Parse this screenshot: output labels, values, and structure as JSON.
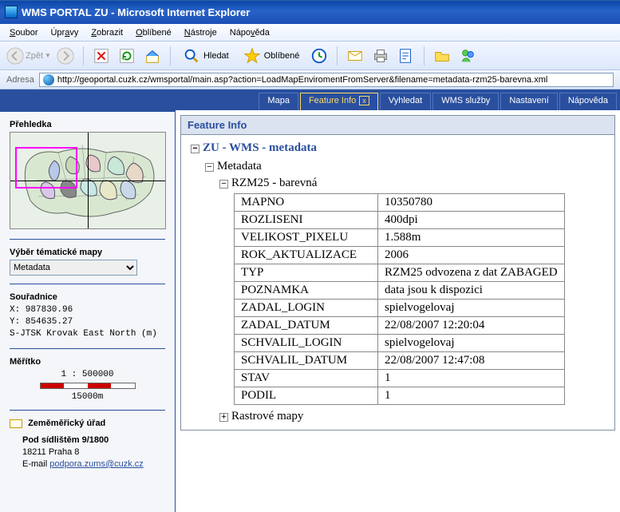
{
  "window": {
    "title": "WMS PORTAL ZU - Microsoft Internet Explorer"
  },
  "menu": {
    "file": "Soubor",
    "edit": "Úpravy",
    "view": "Zobrazit",
    "favorites": "Oblíbené",
    "tools": "Nástroje",
    "help": "Nápověda"
  },
  "toolbar": {
    "back": "Zpět",
    "search": "Hledat",
    "favorites": "Oblíbené"
  },
  "address": {
    "label": "Adresa",
    "url": "http://geoportal.cuzk.cz/wmsportal/main.asp?action=LoadMapEnviromentFromServer&filename=metadata-rzm25-barevna.xml"
  },
  "tabs": {
    "map": "Mapa",
    "feature": "Feature Info",
    "search": "Vyhledat",
    "wms": "WMS služby",
    "settings": "Nastavení",
    "help": "Nápověda"
  },
  "sidebar": {
    "overview_title": "Přehledka",
    "themap_label": "Výběr tématické mapy",
    "themap_value": "Metadata",
    "coords_title": "Souřadnice",
    "x": "X: 987830.96",
    "y": "Y: 854635.27",
    "sys": "S-JTSK Krovak East North (m)",
    "scale_title": "Měřítko",
    "scale_ratio": "1 : 500000",
    "scale_dist": "15000m",
    "office": "Zeměměřický úřad",
    "addr1": "Pod sídlištěm 9/1800",
    "addr2": "18211 Praha 8",
    "email_label": "E-mail ",
    "email": "podpora.zums@cuzk.cz"
  },
  "feature": {
    "title": "Feature Info",
    "group": "ZU - WMS - metadata",
    "sec1": "Metadata",
    "sec2": "RZM25 - barevná",
    "sec3": "Rastrové mapy",
    "table": [
      [
        "MAPNO",
        "10350780"
      ],
      [
        "ROZLISENI",
        "400dpi"
      ],
      [
        "VELIKOST_PIXELU",
        "1.588m"
      ],
      [
        "ROK_AKTUALIZACE",
        "2006"
      ],
      [
        "TYP",
        "RZM25 odvozena z dat ZABAGED"
      ],
      [
        "POZNAMKA",
        "data jsou k dispozici"
      ],
      [
        "ZADAL_LOGIN",
        "spielvogelovaj"
      ],
      [
        "ZADAL_DATUM",
        "22/08/2007 12:20:04"
      ],
      [
        "SCHVALIL_LOGIN",
        "spielvogelovaj"
      ],
      [
        "SCHVALIL_DATUM",
        "22/08/2007 12:47:08"
      ],
      [
        "STAV",
        "1"
      ],
      [
        "PODIL",
        "1"
      ]
    ]
  }
}
